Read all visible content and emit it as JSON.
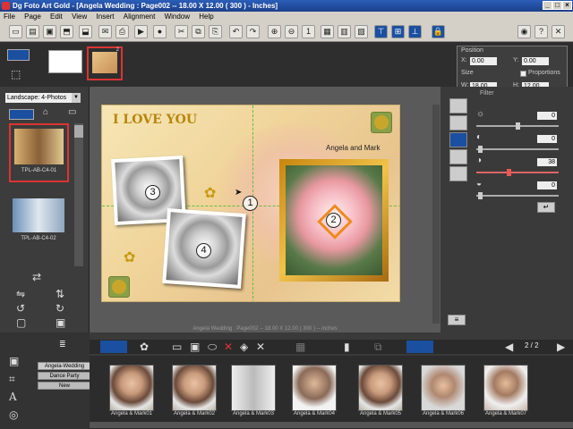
{
  "window": {
    "title": "Dg Foto Art Gold - [Angela Wedding : Page002 -- 18.00 X 12.00 ( 300 ) - Inches]"
  },
  "menu": [
    "File",
    "Page",
    "Edit",
    "View",
    "Insert",
    "Alignment",
    "Window",
    "Help"
  ],
  "left_panel": {
    "layout_combo": "Landscape: 4-Photos",
    "templates": [
      {
        "label": "TPL-AB-C4-01"
      },
      {
        "label": "TPL-AB-C4-02"
      }
    ]
  },
  "pages_strip": {
    "page2_label": "2"
  },
  "position_box": {
    "title": "Position",
    "x_label": "X:",
    "x_value": "0.00",
    "y_label": "Y:",
    "y_value": "0.00",
    "size_label": "Size",
    "proportions_label": "Proportions",
    "w_label": "W:",
    "w_value": "18.00",
    "h_label": "H:",
    "h_value": "12.00"
  },
  "canvas": {
    "headline": "I LOVE YOU",
    "names": "Angela and Mark",
    "markers": [
      "1",
      "2",
      "3",
      "4"
    ],
    "status": "Angela Wedding : Page002 -- 18.00 X 12.00 ( 300 ) -- inches"
  },
  "filter": {
    "title": "Filter",
    "values": [
      "0",
      "0",
      "38",
      "0"
    ]
  },
  "bottom": {
    "pager": "2 / 2",
    "albums": [
      "Angela-Wedding",
      "Dance Party",
      "New"
    ],
    "photos": [
      "Angela & Mark01",
      "Angela & Mark02",
      "Angela & Mark03",
      "Angela & Mark04",
      "Angela & Mark05",
      "Angela & Mark06",
      "Angela & Mark07"
    ]
  },
  "colors": {
    "title_bar": "#1c3f8c",
    "selection": "#dd3333",
    "guide": "#5fbf3f",
    "marker_frame": "#f08a1c"
  }
}
